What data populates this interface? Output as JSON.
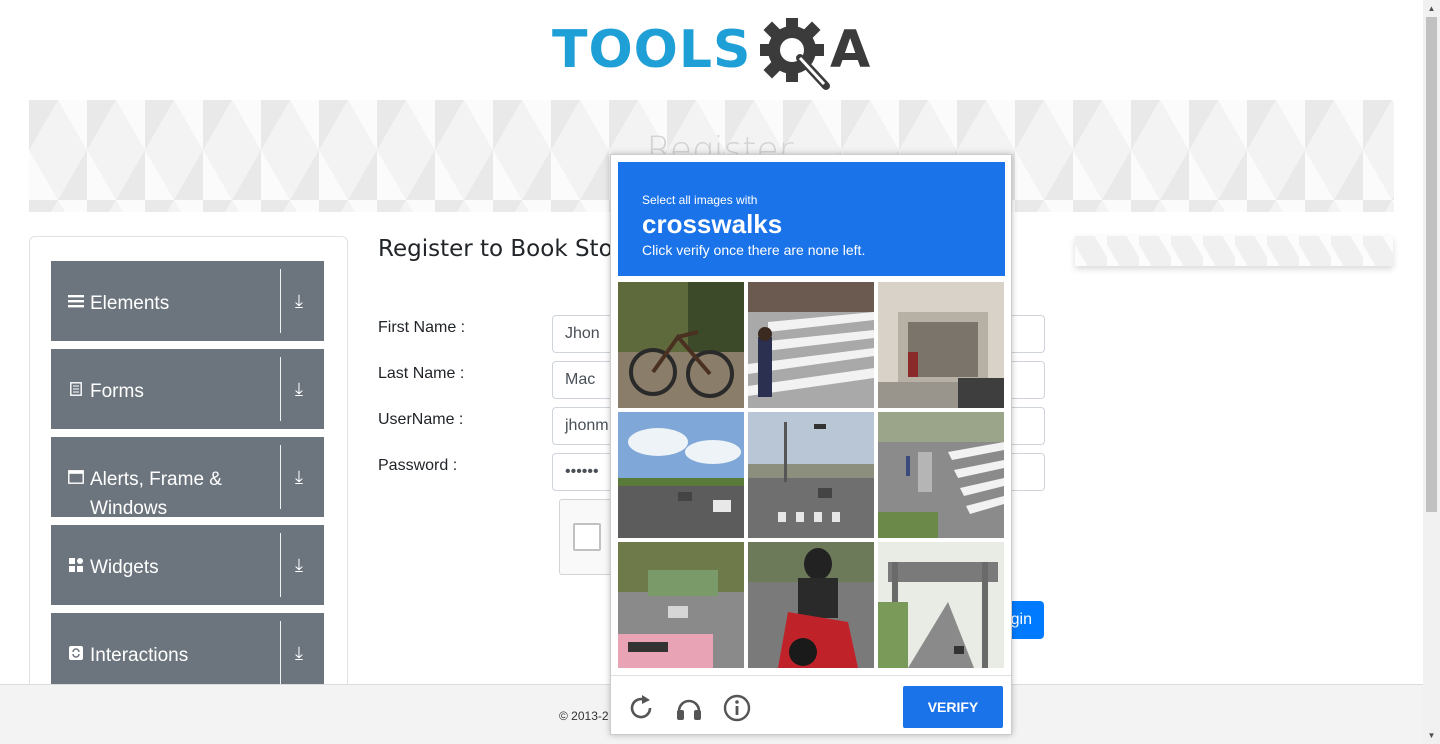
{
  "logo": {
    "text_blue": "TOOLS",
    "text_dark": "A"
  },
  "banner": {
    "title": "Register"
  },
  "sidebar": {
    "groups": [
      {
        "label": "Elements",
        "icon": "hamburger-icon"
      },
      {
        "label": "Forms",
        "icon": "document-icon"
      },
      {
        "label": "Alerts, Frame & Windows",
        "icon": "window-icon"
      },
      {
        "label": "Widgets",
        "icon": "grid-icon"
      },
      {
        "label": "Interactions",
        "icon": "sync-icon"
      }
    ],
    "download_glyph": "⤓"
  },
  "form": {
    "heading": "Register to Book Store",
    "labels": {
      "first_name": "First Name :",
      "last_name": "Last Name :",
      "username": "UserName :",
      "password": "Password :"
    },
    "values": {
      "first_name": "Jhon",
      "last_name": "Mac",
      "username": "jhonm",
      "password": "••••••"
    },
    "login_label": "gin"
  },
  "footer": {
    "text": "© 2013-2"
  },
  "captcha": {
    "prompt_line1": "Select all images with",
    "prompt_target": "crosswalks",
    "prompt_line3": "Click verify once there are none left.",
    "verify_label": "VERIFY",
    "icons": [
      "reload-icon",
      "audio-icon",
      "info-icon"
    ]
  },
  "colors": {
    "captcha_blue": "#1a73e8",
    "sidebar_gray": "#6c757d",
    "logo_blue": "#1e9fd6",
    "primary_button": "#007bff"
  }
}
